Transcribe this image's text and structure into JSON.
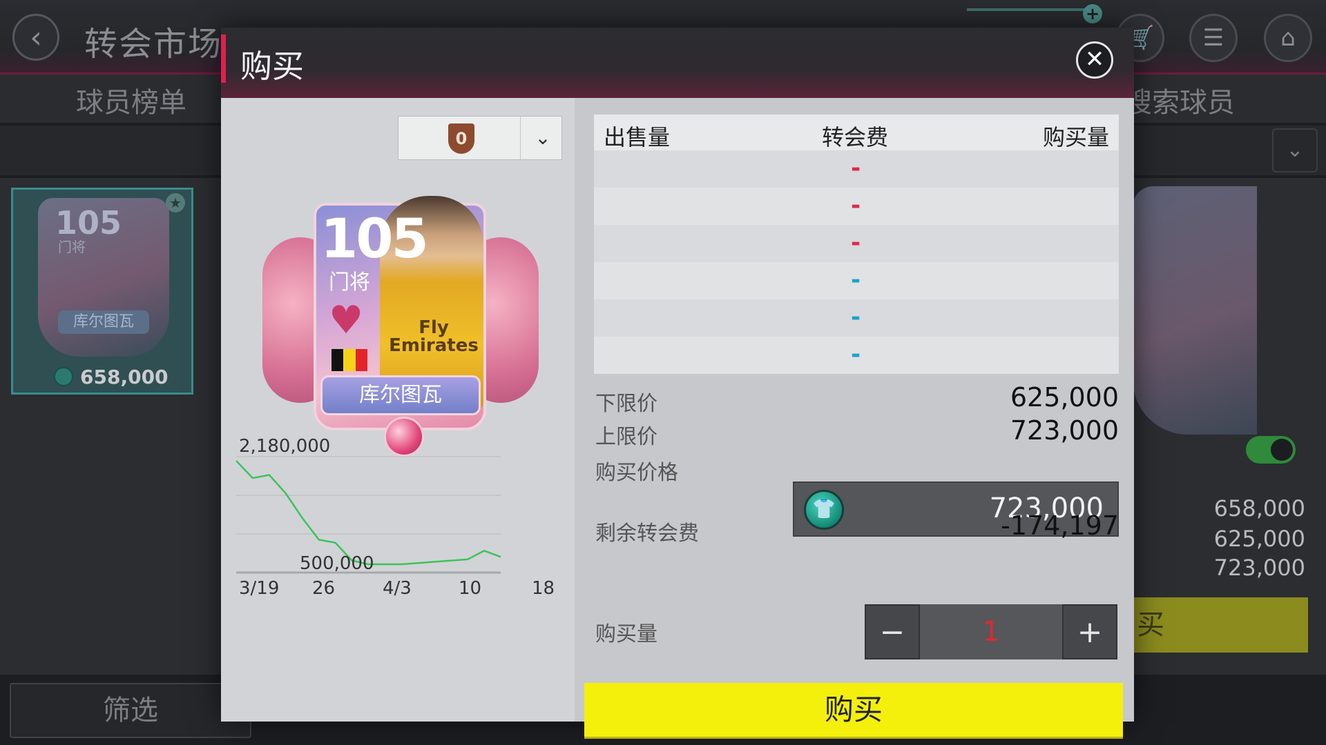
{
  "background": {
    "title": "转会市场",
    "tab_left": "球员榜单",
    "tab_right": "搜索球员",
    "filter_label": "筛选",
    "left_card": {
      "rating": "105",
      "position": "门将",
      "name": "库尔图瓦",
      "price": "658,000"
    },
    "right_values": [
      "658,000",
      "625,000",
      "723,000"
    ],
    "right_buy_partial": "买"
  },
  "modal": {
    "title": "购买",
    "close_icon": "close-icon",
    "rank_value": "0",
    "card": {
      "rating": "105",
      "position": "门将",
      "name": "库尔图瓦",
      "sponsor_line1": "Fly",
      "sponsor_line2": "Emirates",
      "flag_colors": [
        "#111111",
        "#f6d31a",
        "#e0252b"
      ]
    },
    "chart": {
      "y_max_label": "2,180,000",
      "y_min_label": "500,000",
      "x_labels": [
        "3/19",
        "26",
        "4/3",
        "10",
        "18"
      ]
    },
    "table": {
      "headers": {
        "quantity": "出售量",
        "fee": "转会费",
        "buy_qty": "购买量"
      },
      "rows": [
        {
          "fee": "-",
          "color": "#e0284a"
        },
        {
          "fee": "-",
          "color": "#e0284a"
        },
        {
          "fee": "-",
          "color": "#e0284a"
        },
        {
          "fee": "-",
          "color": "#1aa3c9"
        },
        {
          "fee": "-",
          "color": "#1aa3c9"
        },
        {
          "fee": "-",
          "color": "#1aa3c9"
        }
      ]
    },
    "lower_price_label": "下限价",
    "lower_price": "625,000",
    "upper_price_label": "上限价",
    "upper_price": "723,000",
    "buy_price_label": "购买价格",
    "buy_price": "723,000",
    "remaining_label": "剩余转会费",
    "remaining_value": "-174,197",
    "quantity_label": "购买量",
    "quantity_value": "1",
    "minus": "−",
    "plus": "+",
    "buy_button": "购买"
  },
  "chart_data": {
    "type": "line",
    "x": [
      "3/19",
      "3/21",
      "3/23",
      "3/25",
      "3/27",
      "3/29",
      "3/31",
      "4/2",
      "4/4",
      "4/6",
      "4/8",
      "4/10",
      "4/12",
      "4/14",
      "4/16",
      "4/18",
      "4/19"
    ],
    "series": [
      {
        "values": [
          2180000,
          1900000,
          1950000,
          1650000,
          1250000,
          900000,
          850000,
          560000,
          500000,
          500000,
          500000,
          520000,
          540000,
          560000,
          580000,
          720000,
          620000
        ]
      }
    ],
    "tick_labels": [
      "3/19",
      "26",
      "4/3",
      "10",
      "18"
    ],
    "ylim": [
      500000,
      2180000
    ],
    "grid": true,
    "color": "#3cc45a"
  }
}
